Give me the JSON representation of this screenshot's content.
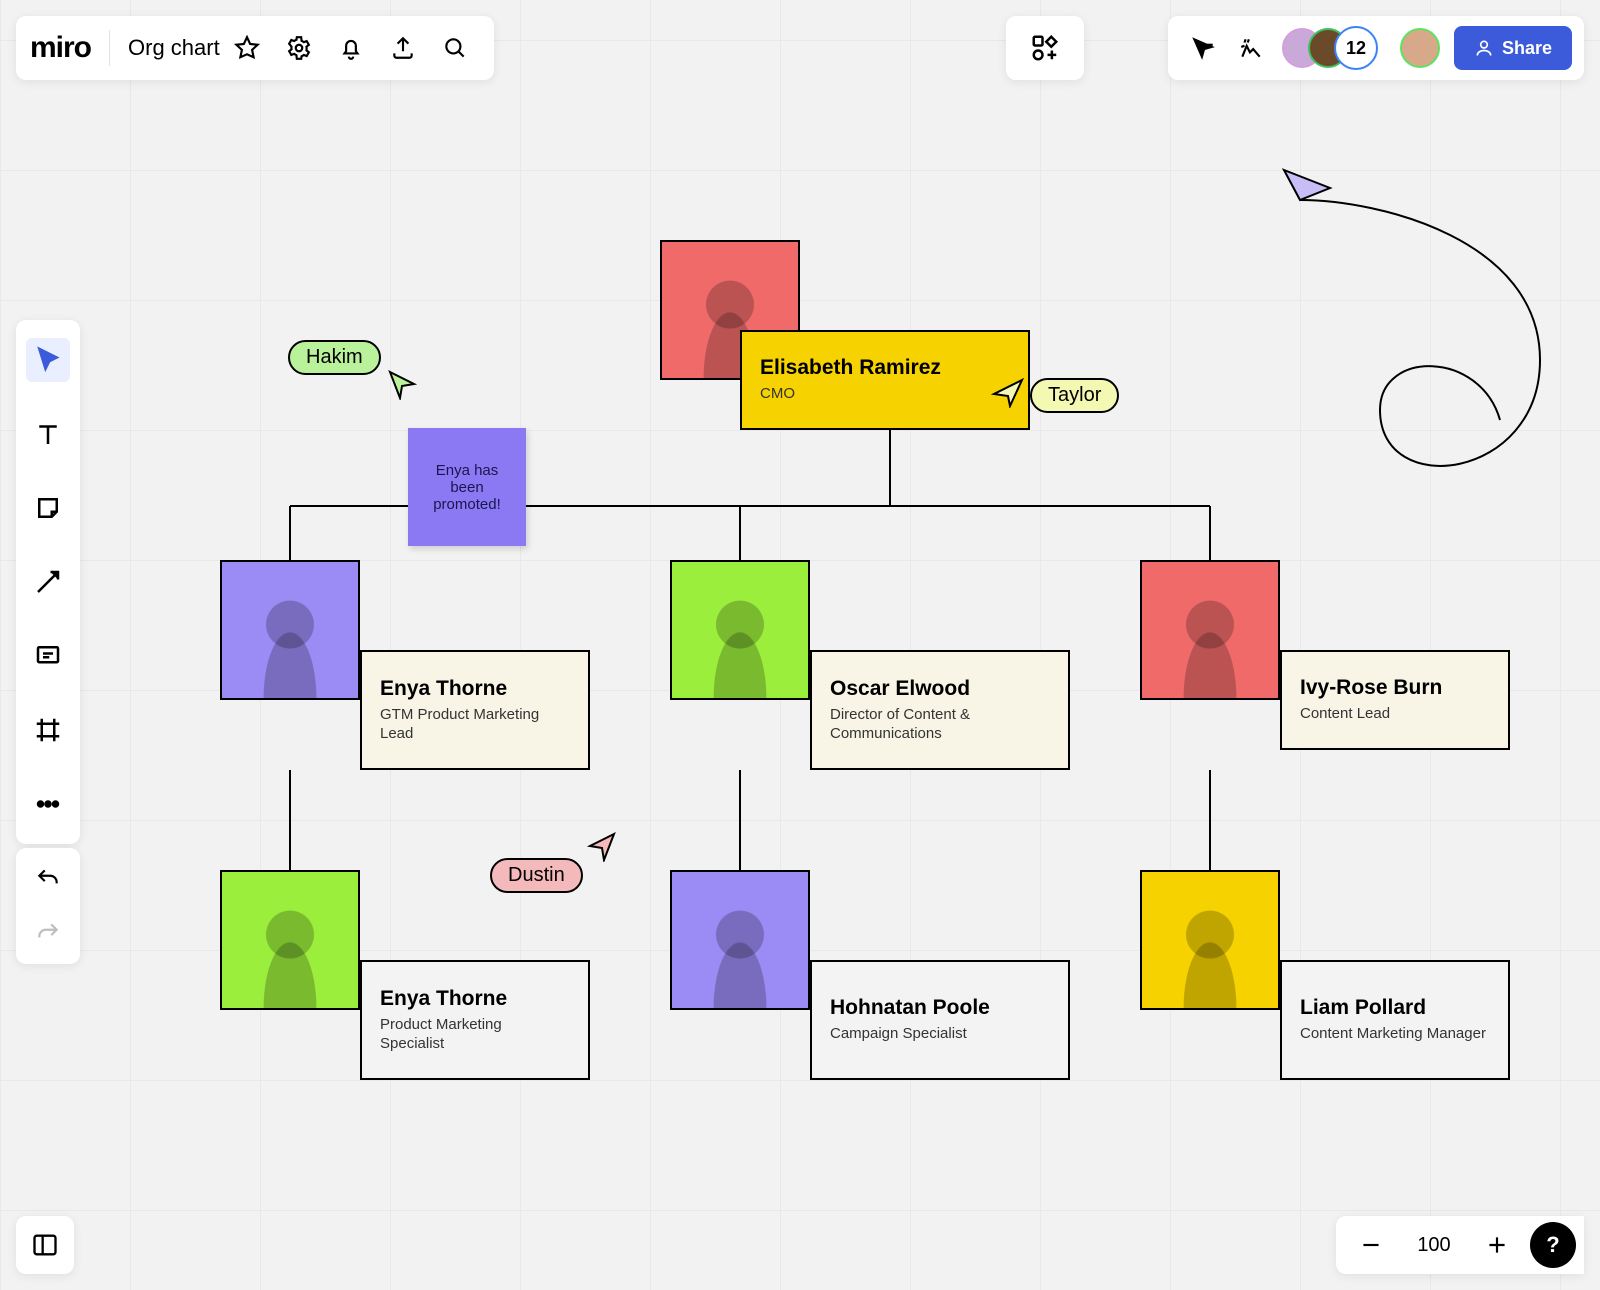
{
  "app": {
    "logo": "miro",
    "board_name": "Org chart"
  },
  "header": {
    "share_label": "Share",
    "more_count": "12"
  },
  "cursors": {
    "hakim": {
      "label": "Hakim",
      "bg": "#b9f29a"
    },
    "taylor": {
      "label": "Taylor",
      "bg": "#f3f8b2"
    },
    "dustin": {
      "label": "Dustin",
      "bg": "#f4b9bb"
    }
  },
  "sticky": {
    "text": "Enya has been promoted!"
  },
  "people": {
    "cmo": {
      "name": "Elisabeth Ramirez",
      "title": "CMO",
      "card_bg": "#f6d200",
      "photo_bg": "#f06a6a"
    },
    "gtm": {
      "name": "Enya Thorne",
      "title": "GTM Product Marketing Lead",
      "card_bg": "#f8f5e7",
      "photo_bg": "#9b8bf4"
    },
    "dir": {
      "name": "Oscar Elwood",
      "title": "Director of Content & Communications",
      "card_bg": "#f8f5e7",
      "photo_bg": "#9bee3c"
    },
    "lead": {
      "name": "Ivy-Rose Burn",
      "title": "Content Lead",
      "card_bg": "#f8f5e7",
      "photo_bg": "#f06a6a"
    },
    "pms": {
      "name": "Enya Thorne",
      "title": "Product Marketing Specialist",
      "card_bg": "#f3f3f3",
      "photo_bg": "#9bee3c"
    },
    "camp": {
      "name": "Hohnatan Poole",
      "title": "Campaign Specialist",
      "card_bg": "#f3f3f3",
      "photo_bg": "#9b8bf4"
    },
    "cmm": {
      "name": "Liam Pollard",
      "title": "Content Marketing Manager",
      "card_bg": "#f3f3f3",
      "photo_bg": "#f6d200"
    }
  },
  "zoom": {
    "level": "100"
  }
}
